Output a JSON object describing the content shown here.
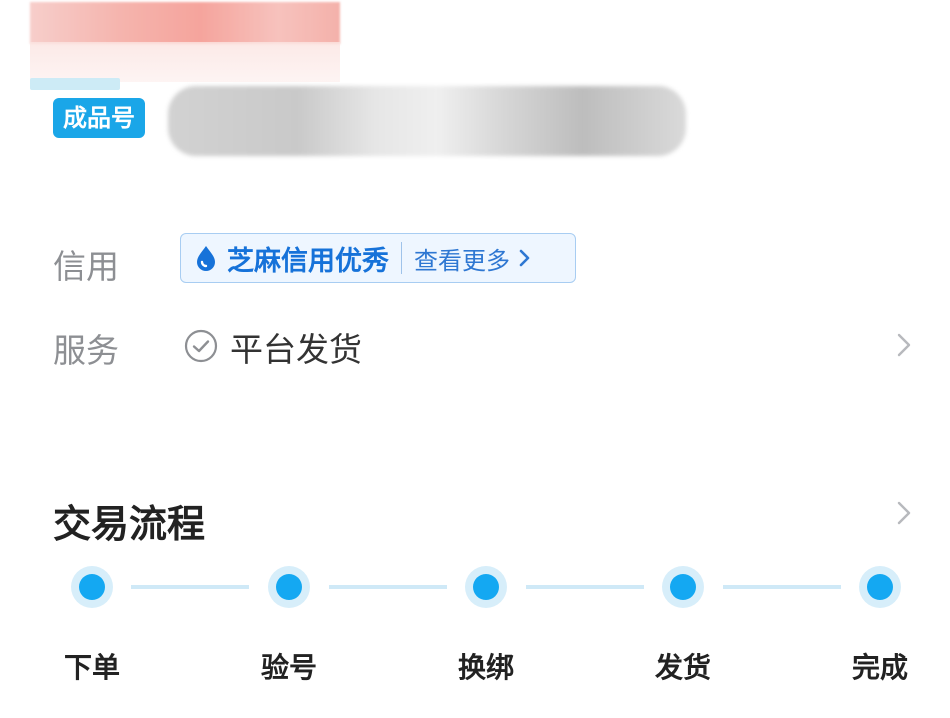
{
  "header": {
    "product_tag": "成品号"
  },
  "credit": {
    "label": "信用",
    "badge_text": "芝麻信用优秀",
    "more_text": "查看更多"
  },
  "service": {
    "label": "服务",
    "text": "平台发货"
  },
  "process": {
    "title": "交易流程",
    "steps": [
      "下单",
      "验号",
      "换绑",
      "发货",
      "完成"
    ]
  },
  "colors": {
    "brand_blue": "#1aa6e8",
    "step_blue": "#14a8f2",
    "credit_blue": "#1672d9"
  },
  "icons": {
    "credit": "water-drop-icon",
    "service": "check-circle-icon",
    "chevron": "chevron-right-icon"
  }
}
